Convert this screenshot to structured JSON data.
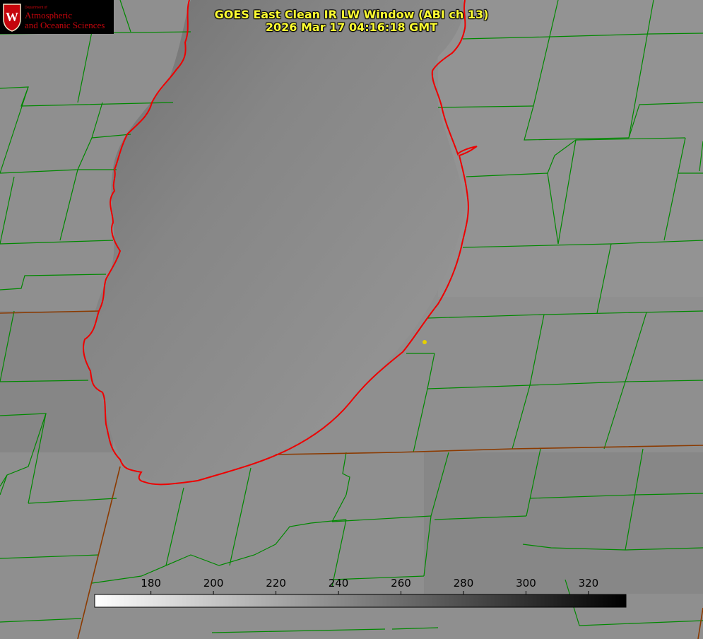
{
  "title": {
    "line1": "GOES East Clean IR LW Window (ABI ch 13)",
    "line2": "2026 Mar 17 04:16:18 GMT"
  },
  "logo": {
    "department": "Department of",
    "line1": "Atmospheric",
    "line2": "and Oceanic Sciences",
    "seal_letter": "W"
  },
  "colorbar": {
    "ticks": [
      "180",
      "200",
      "220",
      "240",
      "260",
      "280",
      "300",
      "320"
    ],
    "tick_values": [
      180,
      200,
      220,
      240,
      260,
      280,
      300,
      320
    ],
    "range": [
      162,
      332
    ],
    "gradient_from": "#ffffff",
    "gradient_to": "#000000"
  },
  "map": {
    "lake_outline_color": "#ff0000",
    "county_line_color": "#008800",
    "state_line_color": "#8b3a00",
    "marker_color": "#e6d000"
  }
}
